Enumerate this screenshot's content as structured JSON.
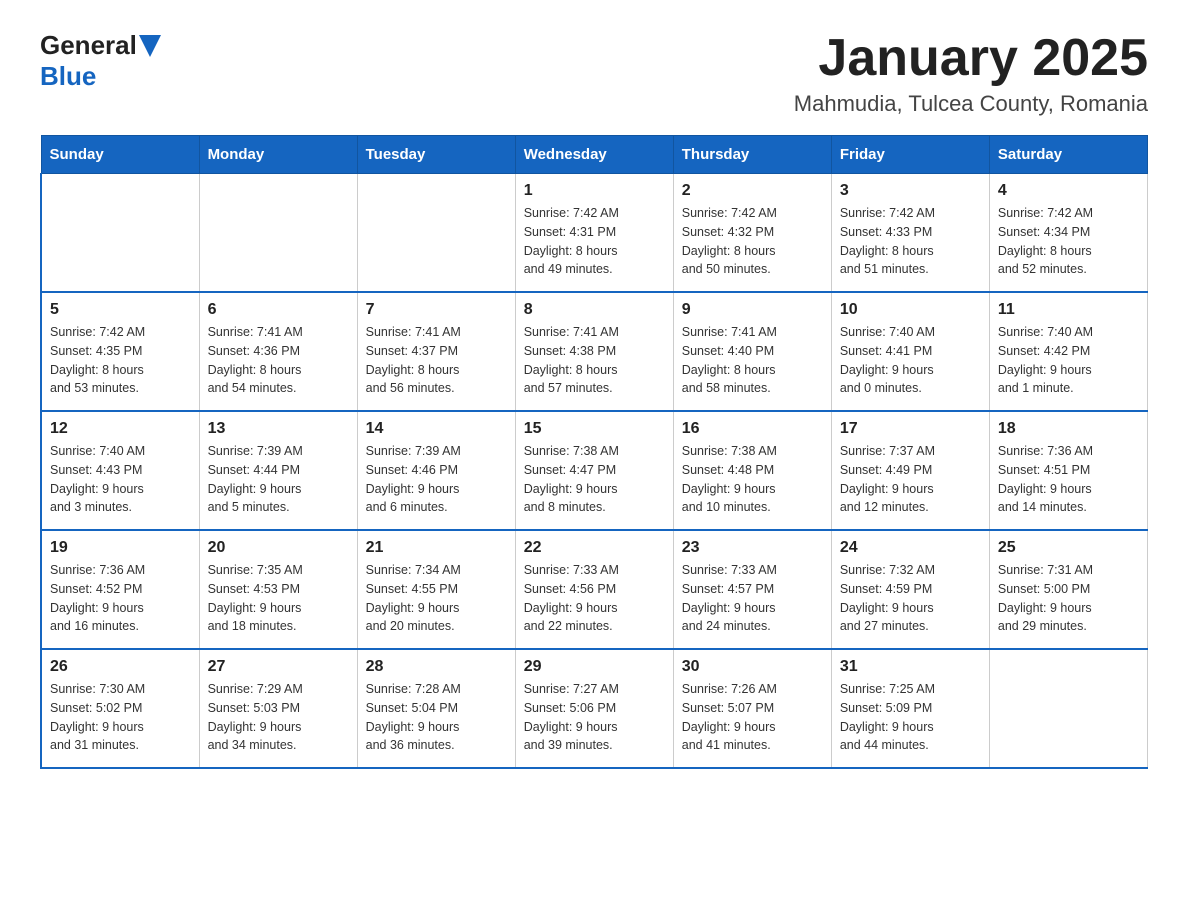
{
  "header": {
    "logo_general": "General",
    "logo_blue": "Blue",
    "title": "January 2025",
    "subtitle": "Mahmudia, Tulcea County, Romania"
  },
  "weekdays": [
    "Sunday",
    "Monday",
    "Tuesday",
    "Wednesday",
    "Thursday",
    "Friday",
    "Saturday"
  ],
  "weeks": [
    [
      {
        "day": "",
        "info": ""
      },
      {
        "day": "",
        "info": ""
      },
      {
        "day": "",
        "info": ""
      },
      {
        "day": "1",
        "info": "Sunrise: 7:42 AM\nSunset: 4:31 PM\nDaylight: 8 hours\nand 49 minutes."
      },
      {
        "day": "2",
        "info": "Sunrise: 7:42 AM\nSunset: 4:32 PM\nDaylight: 8 hours\nand 50 minutes."
      },
      {
        "day": "3",
        "info": "Sunrise: 7:42 AM\nSunset: 4:33 PM\nDaylight: 8 hours\nand 51 minutes."
      },
      {
        "day": "4",
        "info": "Sunrise: 7:42 AM\nSunset: 4:34 PM\nDaylight: 8 hours\nand 52 minutes."
      }
    ],
    [
      {
        "day": "5",
        "info": "Sunrise: 7:42 AM\nSunset: 4:35 PM\nDaylight: 8 hours\nand 53 minutes."
      },
      {
        "day": "6",
        "info": "Sunrise: 7:41 AM\nSunset: 4:36 PM\nDaylight: 8 hours\nand 54 minutes."
      },
      {
        "day": "7",
        "info": "Sunrise: 7:41 AM\nSunset: 4:37 PM\nDaylight: 8 hours\nand 56 minutes."
      },
      {
        "day": "8",
        "info": "Sunrise: 7:41 AM\nSunset: 4:38 PM\nDaylight: 8 hours\nand 57 minutes."
      },
      {
        "day": "9",
        "info": "Sunrise: 7:41 AM\nSunset: 4:40 PM\nDaylight: 8 hours\nand 58 minutes."
      },
      {
        "day": "10",
        "info": "Sunrise: 7:40 AM\nSunset: 4:41 PM\nDaylight: 9 hours\nand 0 minutes."
      },
      {
        "day": "11",
        "info": "Sunrise: 7:40 AM\nSunset: 4:42 PM\nDaylight: 9 hours\nand 1 minute."
      }
    ],
    [
      {
        "day": "12",
        "info": "Sunrise: 7:40 AM\nSunset: 4:43 PM\nDaylight: 9 hours\nand 3 minutes."
      },
      {
        "day": "13",
        "info": "Sunrise: 7:39 AM\nSunset: 4:44 PM\nDaylight: 9 hours\nand 5 minutes."
      },
      {
        "day": "14",
        "info": "Sunrise: 7:39 AM\nSunset: 4:46 PM\nDaylight: 9 hours\nand 6 minutes."
      },
      {
        "day": "15",
        "info": "Sunrise: 7:38 AM\nSunset: 4:47 PM\nDaylight: 9 hours\nand 8 minutes."
      },
      {
        "day": "16",
        "info": "Sunrise: 7:38 AM\nSunset: 4:48 PM\nDaylight: 9 hours\nand 10 minutes."
      },
      {
        "day": "17",
        "info": "Sunrise: 7:37 AM\nSunset: 4:49 PM\nDaylight: 9 hours\nand 12 minutes."
      },
      {
        "day": "18",
        "info": "Sunrise: 7:36 AM\nSunset: 4:51 PM\nDaylight: 9 hours\nand 14 minutes."
      }
    ],
    [
      {
        "day": "19",
        "info": "Sunrise: 7:36 AM\nSunset: 4:52 PM\nDaylight: 9 hours\nand 16 minutes."
      },
      {
        "day": "20",
        "info": "Sunrise: 7:35 AM\nSunset: 4:53 PM\nDaylight: 9 hours\nand 18 minutes."
      },
      {
        "day": "21",
        "info": "Sunrise: 7:34 AM\nSunset: 4:55 PM\nDaylight: 9 hours\nand 20 minutes."
      },
      {
        "day": "22",
        "info": "Sunrise: 7:33 AM\nSunset: 4:56 PM\nDaylight: 9 hours\nand 22 minutes."
      },
      {
        "day": "23",
        "info": "Sunrise: 7:33 AM\nSunset: 4:57 PM\nDaylight: 9 hours\nand 24 minutes."
      },
      {
        "day": "24",
        "info": "Sunrise: 7:32 AM\nSunset: 4:59 PM\nDaylight: 9 hours\nand 27 minutes."
      },
      {
        "day": "25",
        "info": "Sunrise: 7:31 AM\nSunset: 5:00 PM\nDaylight: 9 hours\nand 29 minutes."
      }
    ],
    [
      {
        "day": "26",
        "info": "Sunrise: 7:30 AM\nSunset: 5:02 PM\nDaylight: 9 hours\nand 31 minutes."
      },
      {
        "day": "27",
        "info": "Sunrise: 7:29 AM\nSunset: 5:03 PM\nDaylight: 9 hours\nand 34 minutes."
      },
      {
        "day": "28",
        "info": "Sunrise: 7:28 AM\nSunset: 5:04 PM\nDaylight: 9 hours\nand 36 minutes."
      },
      {
        "day": "29",
        "info": "Sunrise: 7:27 AM\nSunset: 5:06 PM\nDaylight: 9 hours\nand 39 minutes."
      },
      {
        "day": "30",
        "info": "Sunrise: 7:26 AM\nSunset: 5:07 PM\nDaylight: 9 hours\nand 41 minutes."
      },
      {
        "day": "31",
        "info": "Sunrise: 7:25 AM\nSunset: 5:09 PM\nDaylight: 9 hours\nand 44 minutes."
      },
      {
        "day": "",
        "info": ""
      }
    ]
  ]
}
